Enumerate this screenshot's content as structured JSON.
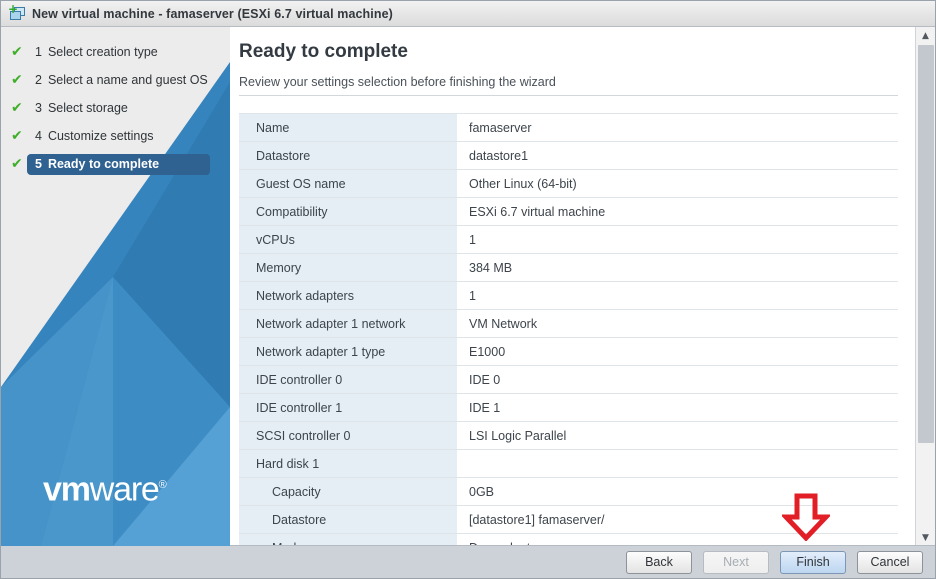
{
  "window": {
    "title": "New virtual machine - famaserver (ESXi 6.7 virtual machine)",
    "icon": "new-virtual-machine-icon"
  },
  "sidebar": {
    "logo": {
      "bold": "vm",
      "rest": "ware",
      "registered": "®"
    },
    "steps": [
      {
        "num": "1",
        "label": "Select creation type",
        "completed": true,
        "active": false
      },
      {
        "num": "2",
        "label": "Select a name and guest OS",
        "completed": true,
        "active": false
      },
      {
        "num": "3",
        "label": "Select storage",
        "completed": true,
        "active": false
      },
      {
        "num": "4",
        "label": "Customize settings",
        "completed": true,
        "active": false
      },
      {
        "num": "5",
        "label": "Ready to complete",
        "completed": true,
        "active": true
      }
    ],
    "check_glyph": "✔"
  },
  "content": {
    "title": "Ready to complete",
    "subtitle": "Review your settings selection before finishing the wizard",
    "summary_rows": [
      {
        "label": "Name",
        "value": "famaserver",
        "indent": false
      },
      {
        "label": "Datastore",
        "value": "datastore1",
        "indent": false
      },
      {
        "label": "Guest OS name",
        "value": "Other Linux (64-bit)",
        "indent": false
      },
      {
        "label": "Compatibility",
        "value": "ESXi 6.7 virtual machine",
        "indent": false
      },
      {
        "label": "vCPUs",
        "value": "1",
        "indent": false
      },
      {
        "label": "Memory",
        "value": "384 MB",
        "indent": false
      },
      {
        "label": "Network adapters",
        "value": "1",
        "indent": false
      },
      {
        "label": "Network adapter 1 network",
        "value": "VM Network",
        "indent": false
      },
      {
        "label": "Network adapter 1 type",
        "value": "E1000",
        "indent": false
      },
      {
        "label": "IDE controller 0",
        "value": "IDE 0",
        "indent": false
      },
      {
        "label": "IDE controller 1",
        "value": "IDE 1",
        "indent": false
      },
      {
        "label": "SCSI controller 0",
        "value": "LSI Logic Parallel",
        "indent": false
      },
      {
        "label": "Hard disk 1",
        "value": "",
        "indent": false
      },
      {
        "label": "Capacity",
        "value": "0GB",
        "indent": true
      },
      {
        "label": "Datastore",
        "value": "[datastore1] famaserver/",
        "indent": true
      },
      {
        "label": "Mode",
        "value": "Dependent",
        "indent": true
      }
    ]
  },
  "scrollbar": {
    "up_glyph": "▲",
    "down_glyph": "▼"
  },
  "footer": {
    "buttons": [
      {
        "label": "Back",
        "state": "enabled"
      },
      {
        "label": "Next",
        "state": "disabled"
      },
      {
        "label": "Finish",
        "state": "primary"
      },
      {
        "label": "Cancel",
        "state": "enabled"
      }
    ]
  },
  "annotation": {
    "arrow": "red-down-arrow",
    "color": "#e21f26"
  }
}
